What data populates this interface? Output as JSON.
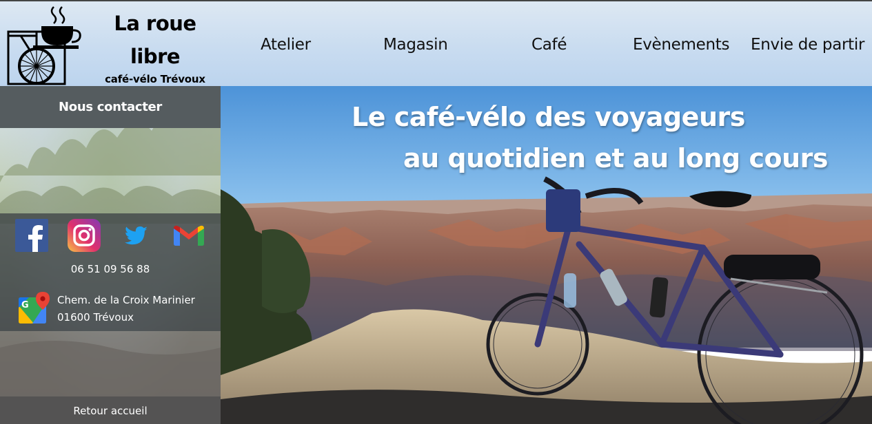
{
  "brand": {
    "name": "La roue libre",
    "tagline": "café-vélo Trévoux"
  },
  "nav": {
    "items": [
      {
        "label": "Atelier"
      },
      {
        "label": "Magasin"
      },
      {
        "label": "Café"
      },
      {
        "label": "Evènements"
      },
      {
        "label": "Envie de partir"
      }
    ]
  },
  "sidebar": {
    "contact_label": "Nous contacter",
    "social": [
      "facebook-icon",
      "instagram-icon",
      "twitter-icon",
      "gmail-icon"
    ],
    "phone": "06 51 09 56 88",
    "address": {
      "line1": "Chem. de la Croix Marinier",
      "line2": "01600 Trévoux"
    },
    "back_label": "Retour accueil"
  },
  "hero": {
    "line1": "Le café-vélo des voyageurs",
    "line2": "au quotidien et au long cours"
  },
  "colors": {
    "contact_bar": "#555c5f",
    "sky": "#6aa6de",
    "bike_frame": "#3b3a78"
  }
}
